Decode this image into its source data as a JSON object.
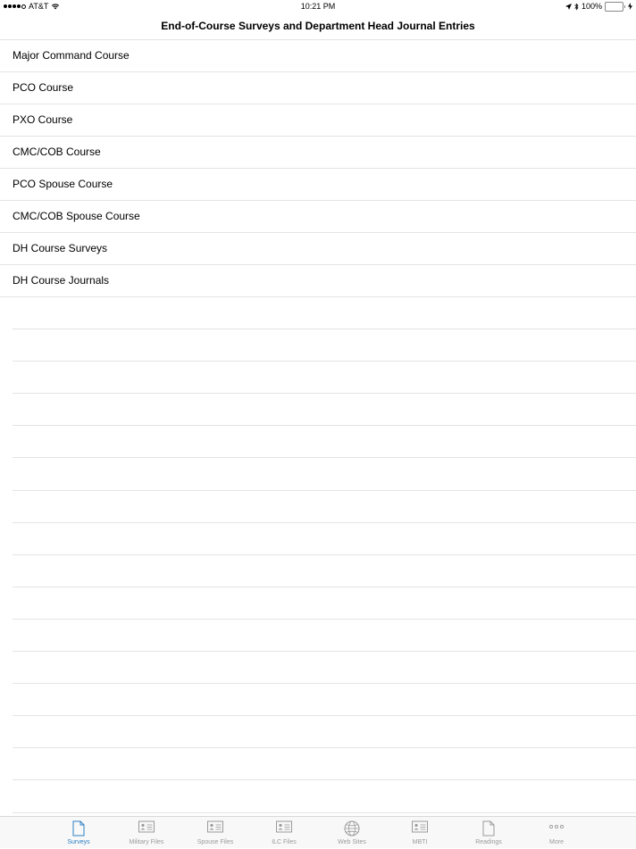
{
  "status_bar": {
    "carrier": "AT&T",
    "time": "10:21 PM",
    "battery_percent_text": "100%",
    "battery_level": 1.0
  },
  "nav": {
    "title": "End-of-Course Surveys and Department Head Journal Entries"
  },
  "list": {
    "items": [
      "Major Command Course",
      "PCO Course",
      "PXO Course",
      "CMC/COB Course",
      "PCO Spouse Course",
      "CMC/COB Spouse Course",
      "DH Course Surveys",
      "DH Course Journals"
    ]
  },
  "tabs": [
    {
      "label": "Surveys",
      "icon": "document-icon",
      "active": true
    },
    {
      "label": "Military Files",
      "icon": "id-card-icon",
      "active": false
    },
    {
      "label": "Spouse Files",
      "icon": "id-card-icon",
      "active": false
    },
    {
      "label": "ILC Files",
      "icon": "id-card-icon",
      "active": false
    },
    {
      "label": "Web Sites",
      "icon": "globe-icon",
      "active": false
    },
    {
      "label": "MBTI",
      "icon": "id-card-icon",
      "active": false
    },
    {
      "label": "Readings",
      "icon": "document-icon",
      "active": false
    },
    {
      "label": "More",
      "icon": "more-dots-icon",
      "active": false
    }
  ],
  "colors": {
    "active_tab": "#2d7fc4",
    "inactive_tab": "#9a9a9a",
    "battery": "#4cd964",
    "separator": "#e4e4e4"
  }
}
